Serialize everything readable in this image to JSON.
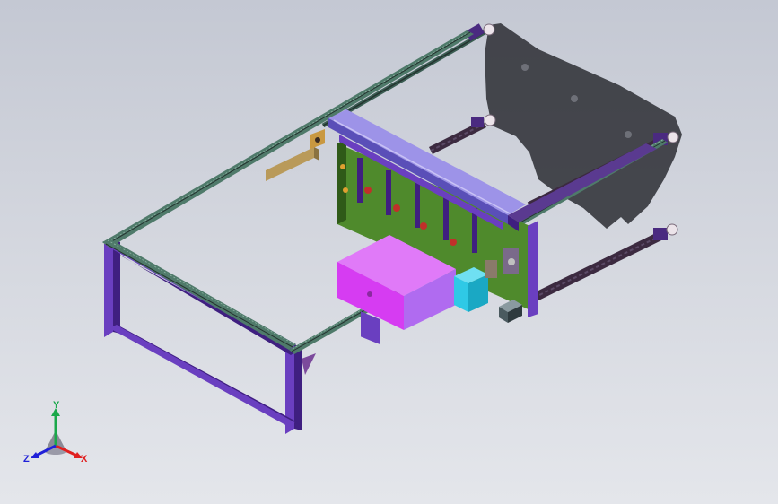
{
  "viewport": {
    "background_top": "#c4c8d3",
    "background_bottom": "#e4e6eb"
  },
  "model": {
    "colors": {
      "frame_purple": "#6a3fc0",
      "frame_purple_dark": "#3f1f80",
      "rail_green": "#3a5c52",
      "rail_dark": "#24332f",
      "pcb_green": "#4f8a2c",
      "box_magenta": "#d63cf2",
      "box_violet": "#b06bf0",
      "block_cyan": "#2fc9e6",
      "beam_lavender": "#9d93e8",
      "rod_dark": "#3c2a40",
      "bracket_tan": "#b99a5a",
      "shadow": "#2b2d33"
    }
  },
  "triad": {
    "x_label": "X",
    "y_label": "Y",
    "z_label": "Z",
    "x_color": "#e02020",
    "y_color": "#1aa84a",
    "z_color": "#2020d8"
  }
}
